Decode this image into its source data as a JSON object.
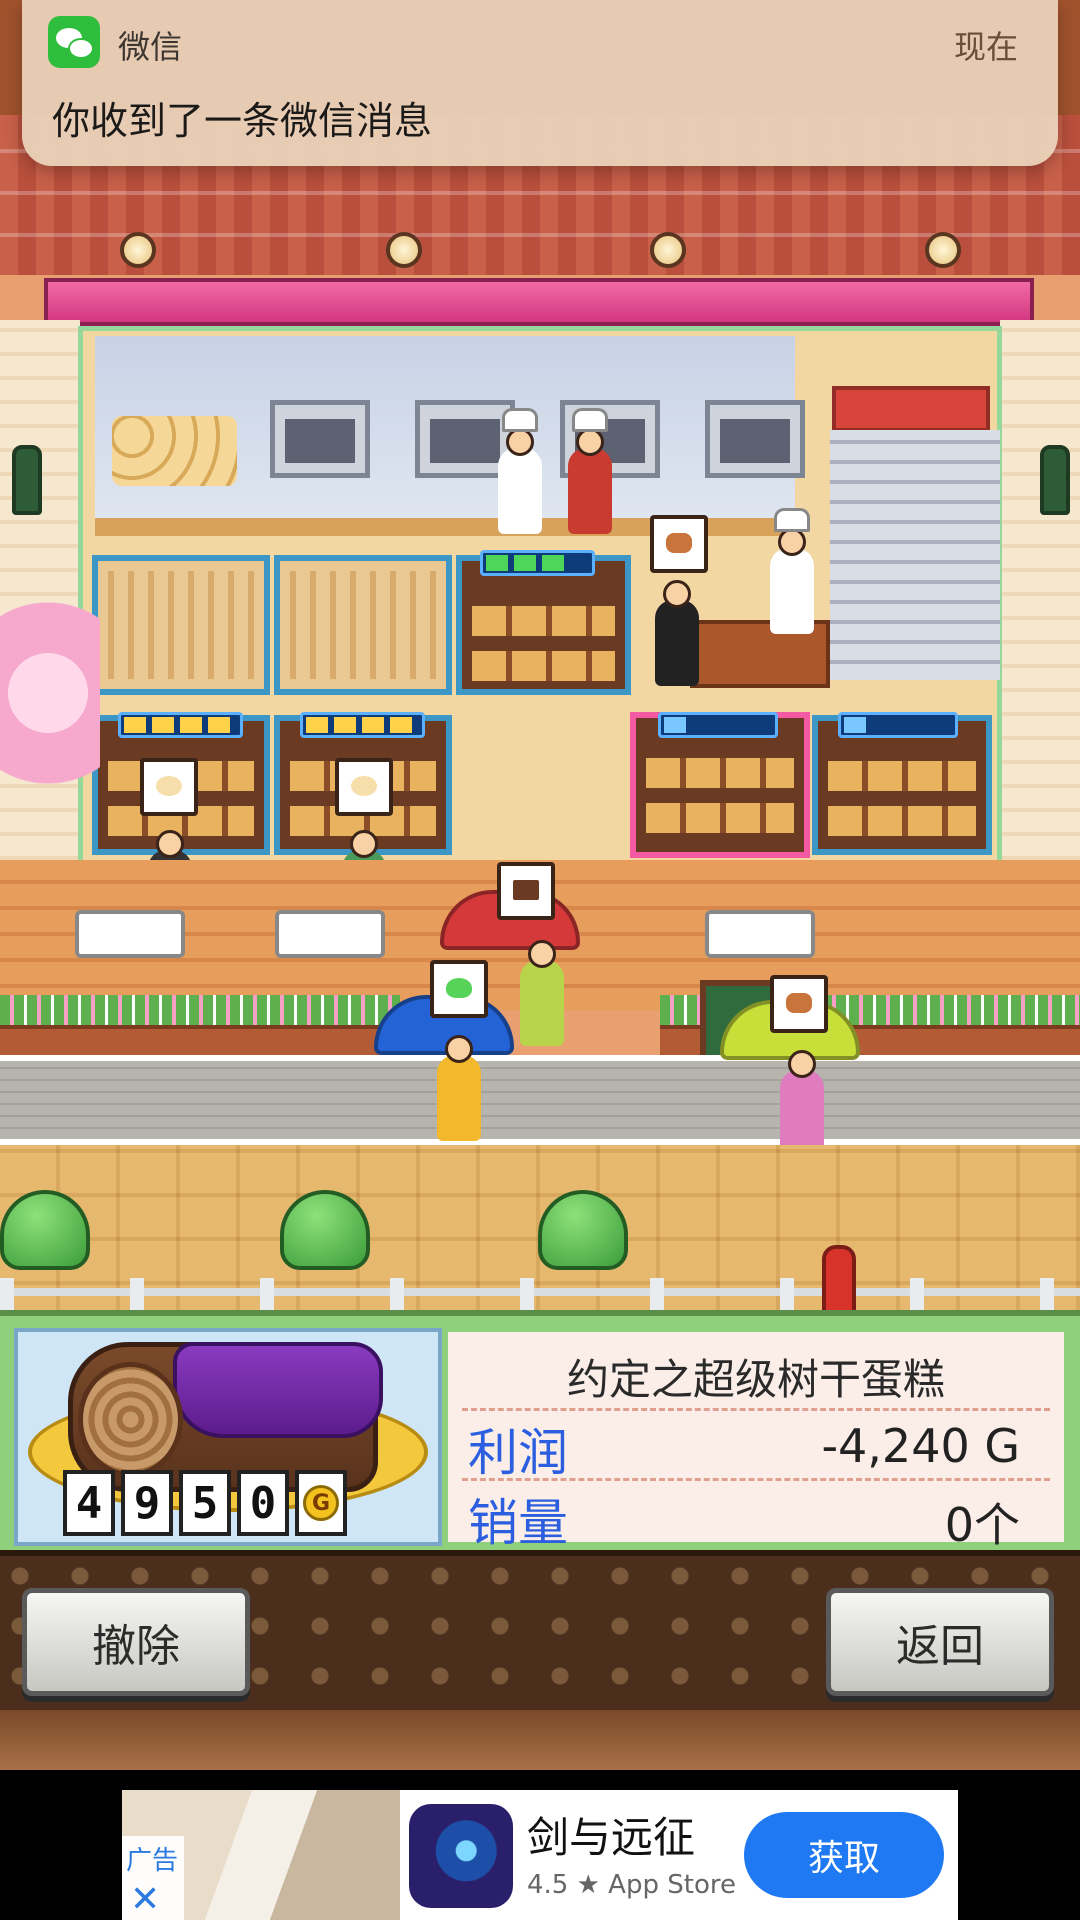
{
  "notification": {
    "app_name": "微信",
    "time": "现在",
    "message": "你收到了一条微信消息",
    "icon": "wechat-icon"
  },
  "product_panel": {
    "product_name": "约定之超级树干蛋糕",
    "price_digits": [
      "4",
      "9",
      "5",
      "0"
    ],
    "currency_symbol": "G",
    "stats": [
      {
        "label": "利润",
        "value": "-4,240 G"
      },
      {
        "label": "销量",
        "value": "0个"
      }
    ]
  },
  "buttons": {
    "remove_label": "撤除",
    "back_label": "返回"
  },
  "ad": {
    "tag_label": "广告",
    "close_glyph": "✕",
    "app_title": "剑与远征",
    "rating": "4.5 ★ App Store",
    "cta_label": "获取"
  },
  "colors": {
    "stat_label": "#2b5fe0",
    "ad_button": "#1f79f2",
    "wechat_green": "#2fbd3d"
  }
}
